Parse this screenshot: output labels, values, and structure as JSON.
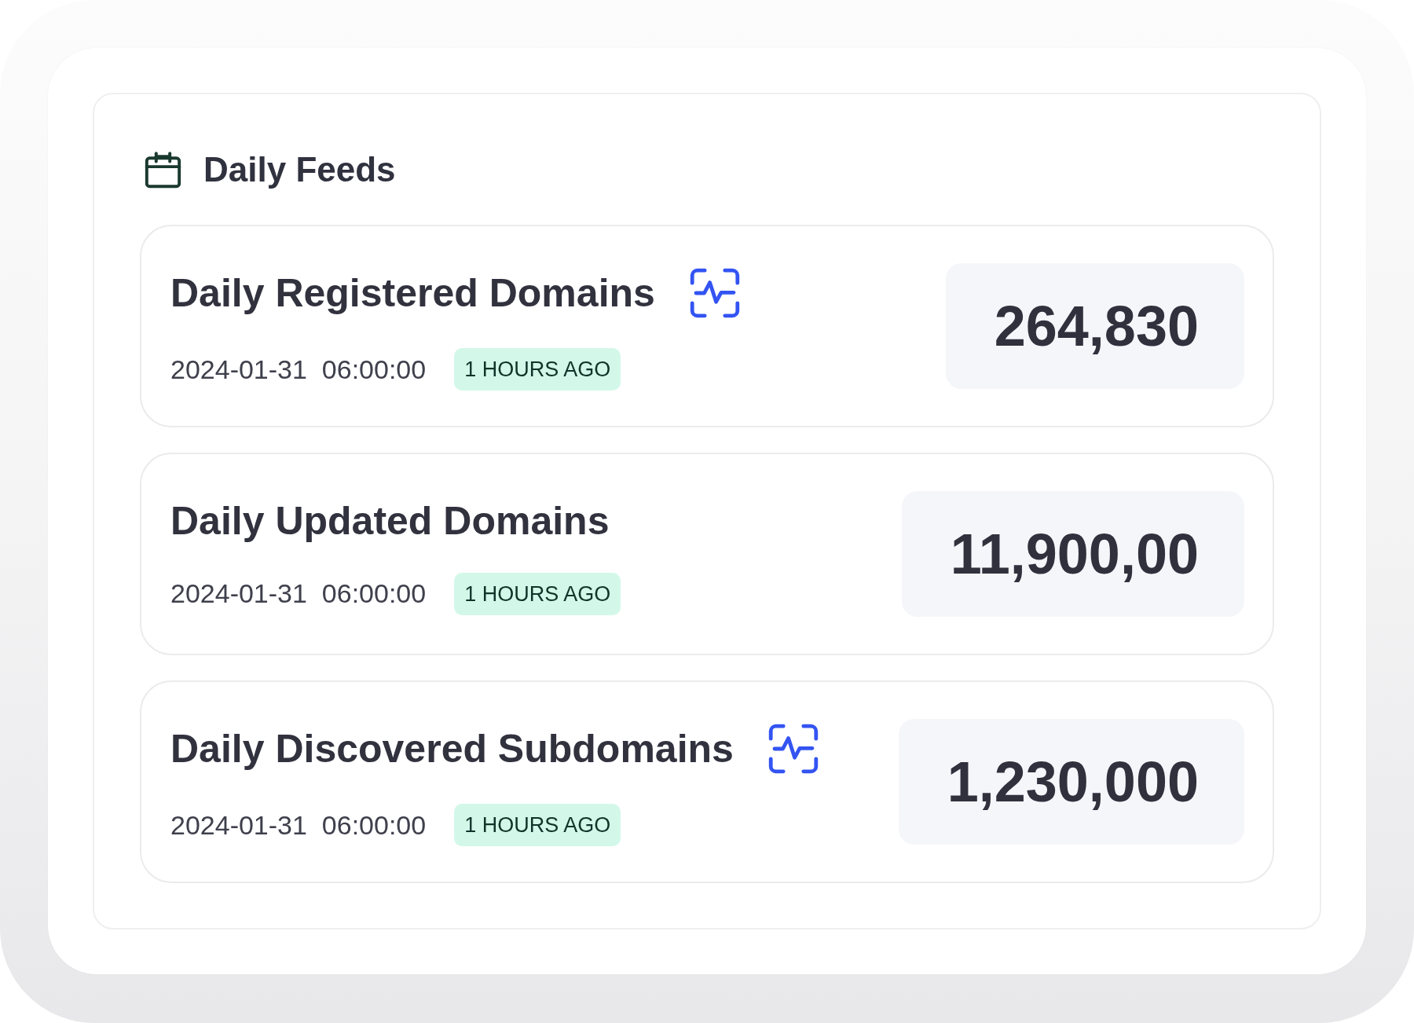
{
  "header": {
    "title": "Daily Feeds"
  },
  "feeds": [
    {
      "title": "Daily Registered Domains",
      "activity_icon": true,
      "timestamp": "2024-01-31  06:00:00",
      "age": "1 HOURS AGO",
      "count": "264,830"
    },
    {
      "title": "Daily Updated Domains",
      "activity_icon": false,
      "timestamp": "2024-01-31  06:00:00",
      "age": "1 HOURS AGO",
      "count": "11,900,00"
    },
    {
      "title": "Daily Discovered Subdomains",
      "activity_icon": true,
      "timestamp": "2024-01-31  06:00:00",
      "age": "1 HOURS AGO",
      "count": "1,230,000"
    }
  ]
}
